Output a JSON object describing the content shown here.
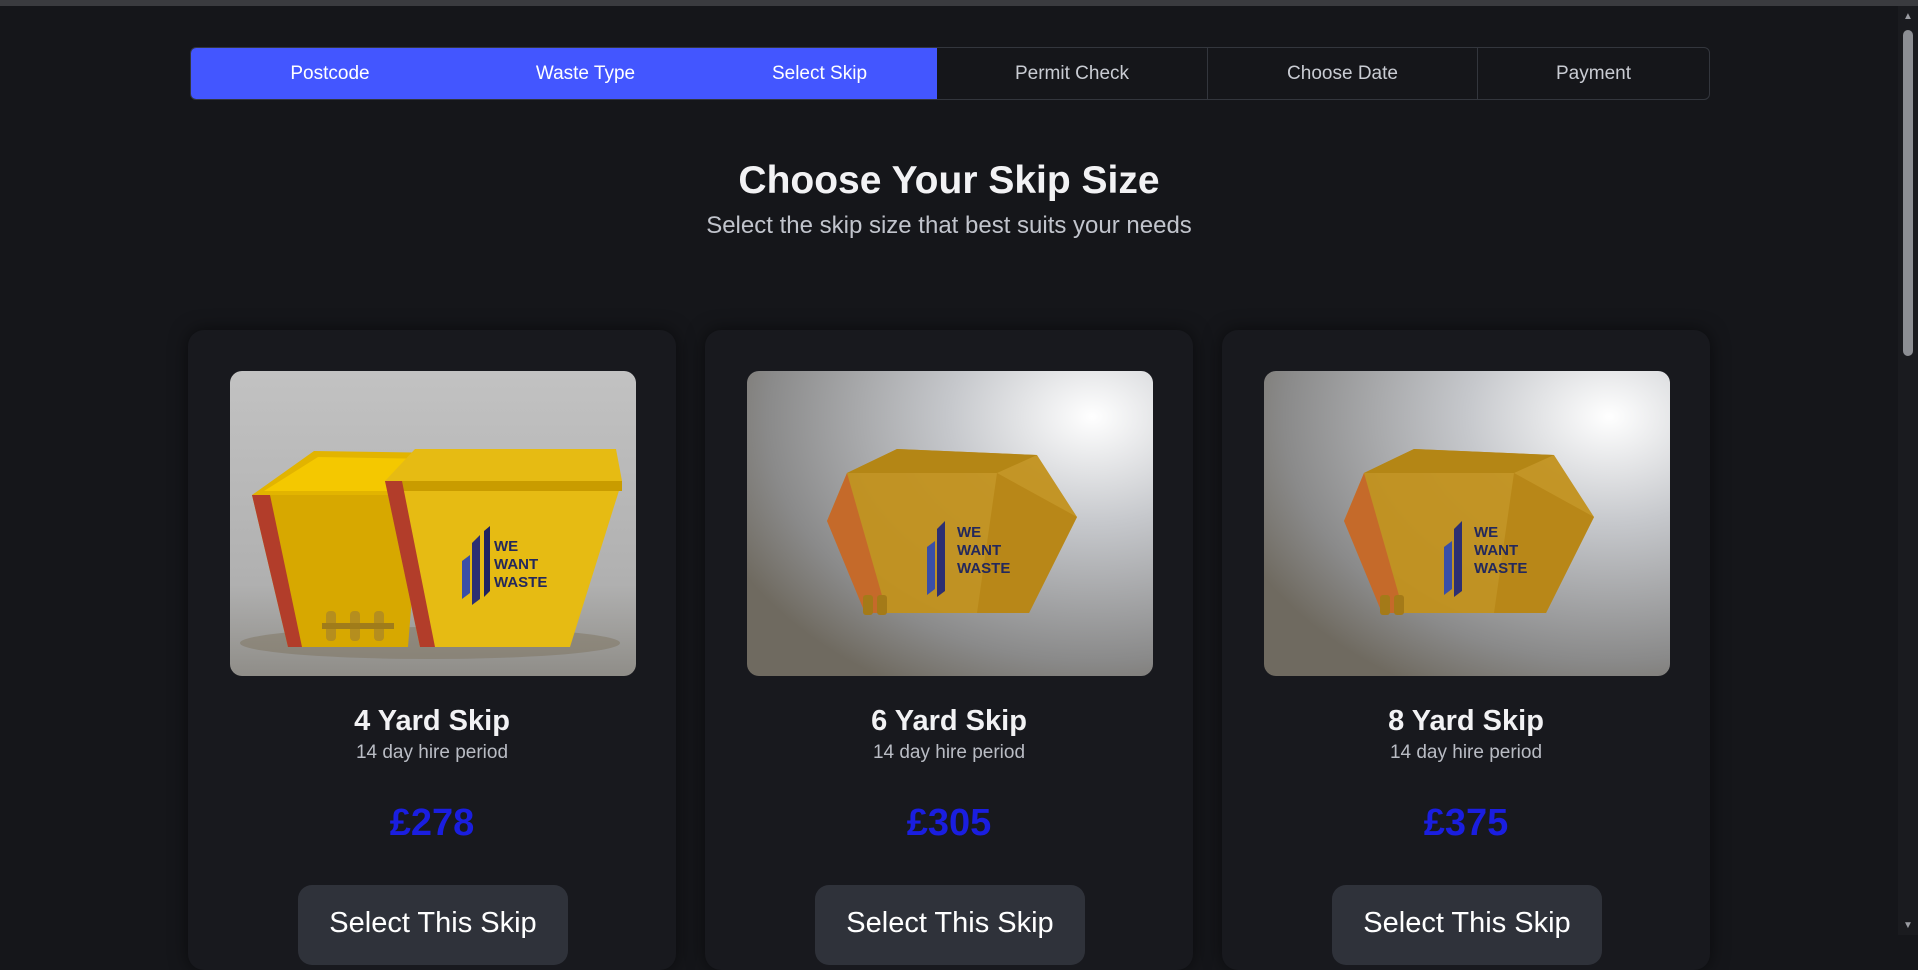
{
  "steps": [
    {
      "label": "Postcode",
      "done": true
    },
    {
      "label": "Waste Type",
      "done": true
    },
    {
      "label": "Select Skip",
      "done": true
    },
    {
      "label": "Permit Check",
      "done": false
    },
    {
      "label": "Choose Date",
      "done": false
    },
    {
      "label": "Payment",
      "done": false
    }
  ],
  "header": {
    "title": "Choose Your Skip Size",
    "subtitle": "Select the skip size that best suits your needs"
  },
  "cards": [
    {
      "title": "4 Yard Skip",
      "period": "14 day hire period",
      "price": "£278",
      "button": "Select This Skip",
      "image_brand": [
        "WE",
        "WANT",
        "WASTE"
      ]
    },
    {
      "title": "6 Yard Skip",
      "period": "14 day hire period",
      "price": "£305",
      "button": "Select This Skip",
      "image_brand": [
        "WE",
        "WANT",
        "WASTE"
      ]
    },
    {
      "title": "8 Yard Skip",
      "period": "14 day hire period",
      "price": "£375",
      "button": "Select This Skip",
      "image_brand": [
        "WE",
        "WANT",
        "WASTE"
      ]
    }
  ],
  "colors": {
    "accent": "#4356ff",
    "background": "#15161a",
    "price": "#1a1ee0",
    "card": "#18191e",
    "button": "#2f323a"
  },
  "icons": {
    "scroll_up": "triangle-up-icon",
    "scroll_down": "triangle-down-icon"
  }
}
